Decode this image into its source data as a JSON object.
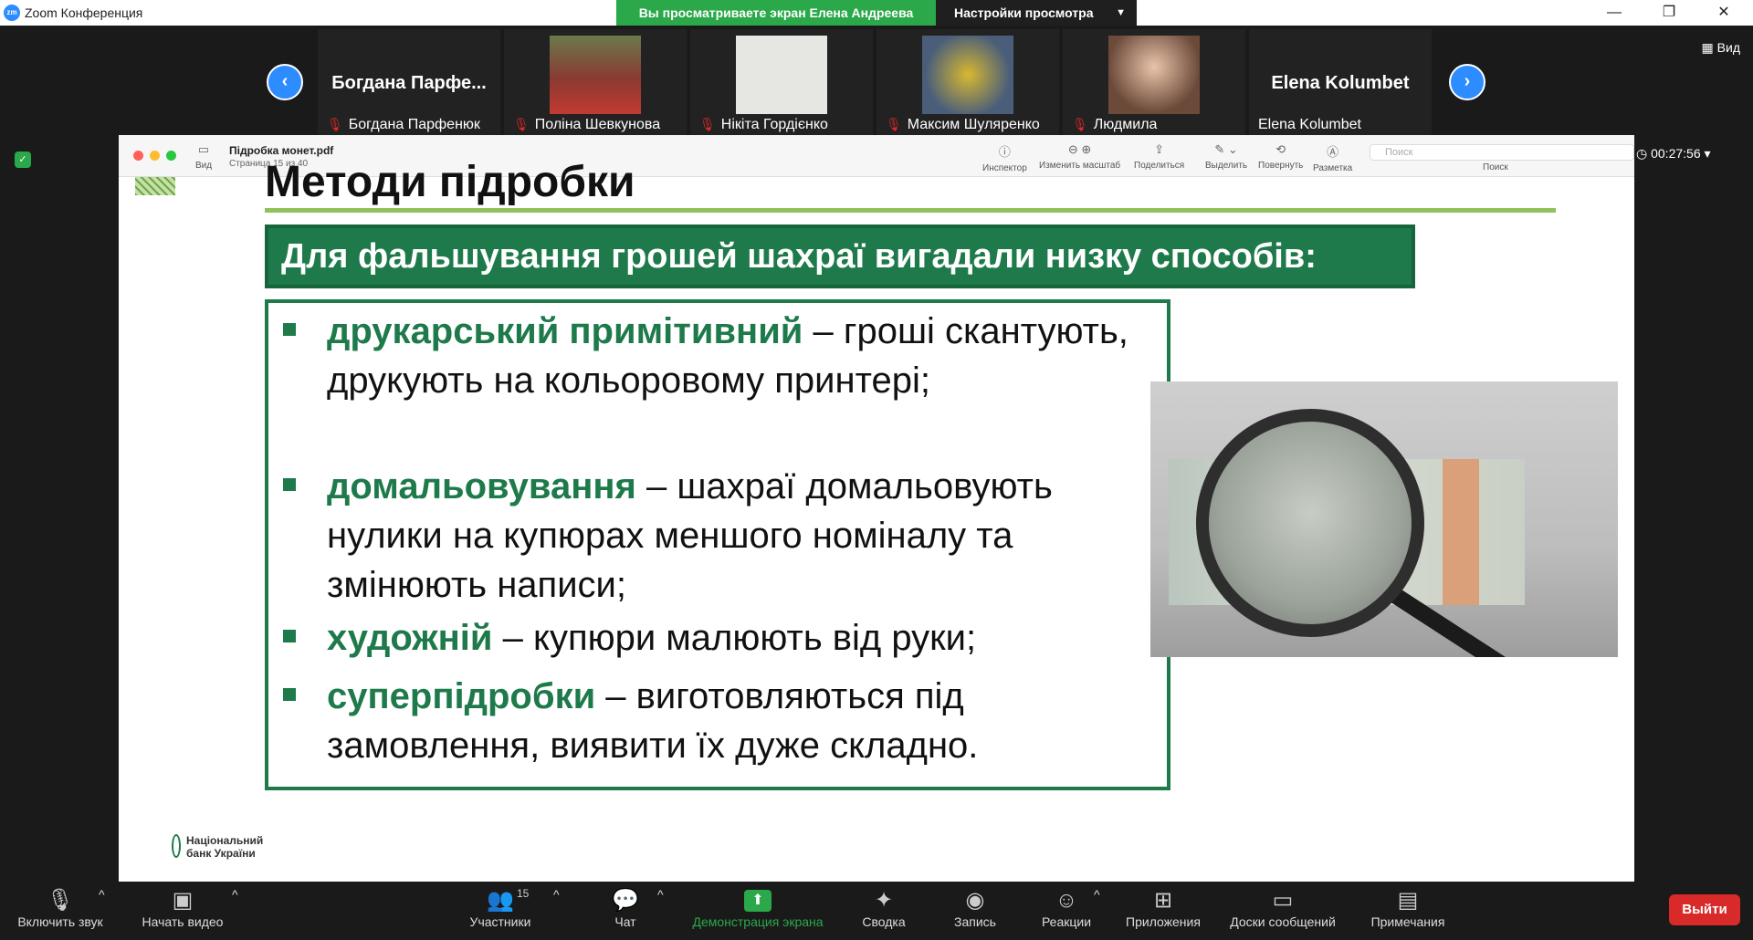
{
  "window": {
    "app_logo": "zm",
    "title": "Zoom Конференция",
    "share_banner": "Вы просматриваете экран Елена Андреева",
    "view_settings": "Настройки просмотра",
    "minimize": "—",
    "restore": "❐",
    "close": "✕"
  },
  "strip": {
    "prev": "‹",
    "next": "›",
    "view_label": "▦ Вид",
    "participants": [
      {
        "big_name": "Богдана  Парфе...",
        "label": "Богдана Парфенюк",
        "muted": true,
        "has_photo": false
      },
      {
        "big_name": "",
        "label": "Поліна Шевкунова",
        "muted": true,
        "has_photo": true,
        "photo_color": "#8a3a32"
      },
      {
        "big_name": "",
        "label": "Нікіта Гордієнко",
        "muted": true,
        "has_photo": true,
        "photo_color": "#e6e6e2"
      },
      {
        "big_name": "",
        "label": "Максим Шуляренко",
        "muted": true,
        "has_photo": true,
        "photo_color": "#4a5e7a"
      },
      {
        "big_name": "",
        "label": "Людмила",
        "muted": true,
        "has_photo": true,
        "photo_color": "#6b4a3a"
      },
      {
        "big_name": "Elena Kolumbet",
        "label": "Elena Kolumbet",
        "muted": false,
        "has_photo": false
      }
    ]
  },
  "pdf": {
    "view_label": "Вид",
    "file_name": "Підробка монет.pdf",
    "page_info": "Страница 15 из 40",
    "tools": [
      "Инспектор",
      "Изменить масштаб",
      "Поделиться",
      "Выделить",
      "Повернуть",
      "Разметка"
    ],
    "search_placeholder": "Поиск",
    "search_label": "Поиск"
  },
  "slide": {
    "title": "Методи підробки",
    "banner": "Для фальшування грошей шахраї вигадали низку способів:",
    "items": [
      {
        "term": "друкарський примітивний",
        "desc": " – гроші скантують, друкують на кольоровому принтері;"
      },
      {
        "term": "домальовування",
        "desc": " – шахраї домальовують нулики на купюрах меншого номіналу та змінюють написи;"
      },
      {
        "term": "художній",
        "desc": " – купюри малюють від руки;"
      },
      {
        "term": "суперпідробки",
        "desc": " – виготовляються під замовлення,  виявити їх дуже складно."
      }
    ],
    "logo_line1": "Національний",
    "logo_line2": "банк України"
  },
  "timer": "00:27:56",
  "toolbar": {
    "mic": "Включить звук",
    "video": "Начать видео",
    "participants": "Участники",
    "participants_count": "15",
    "chat": "Чат",
    "share": "Демонстрация экрана",
    "summary": "Сводка",
    "record": "Запись",
    "reactions": "Реакции",
    "apps": "Приложения",
    "whiteboards": "Доски сообщений",
    "notes": "Примечания",
    "leave": "Выйти"
  },
  "colors": {
    "accent": "#2d8cff",
    "share_green": "#2aa84a",
    "slide_green": "#1e7a4a",
    "leave_red": "#d92a2a"
  }
}
